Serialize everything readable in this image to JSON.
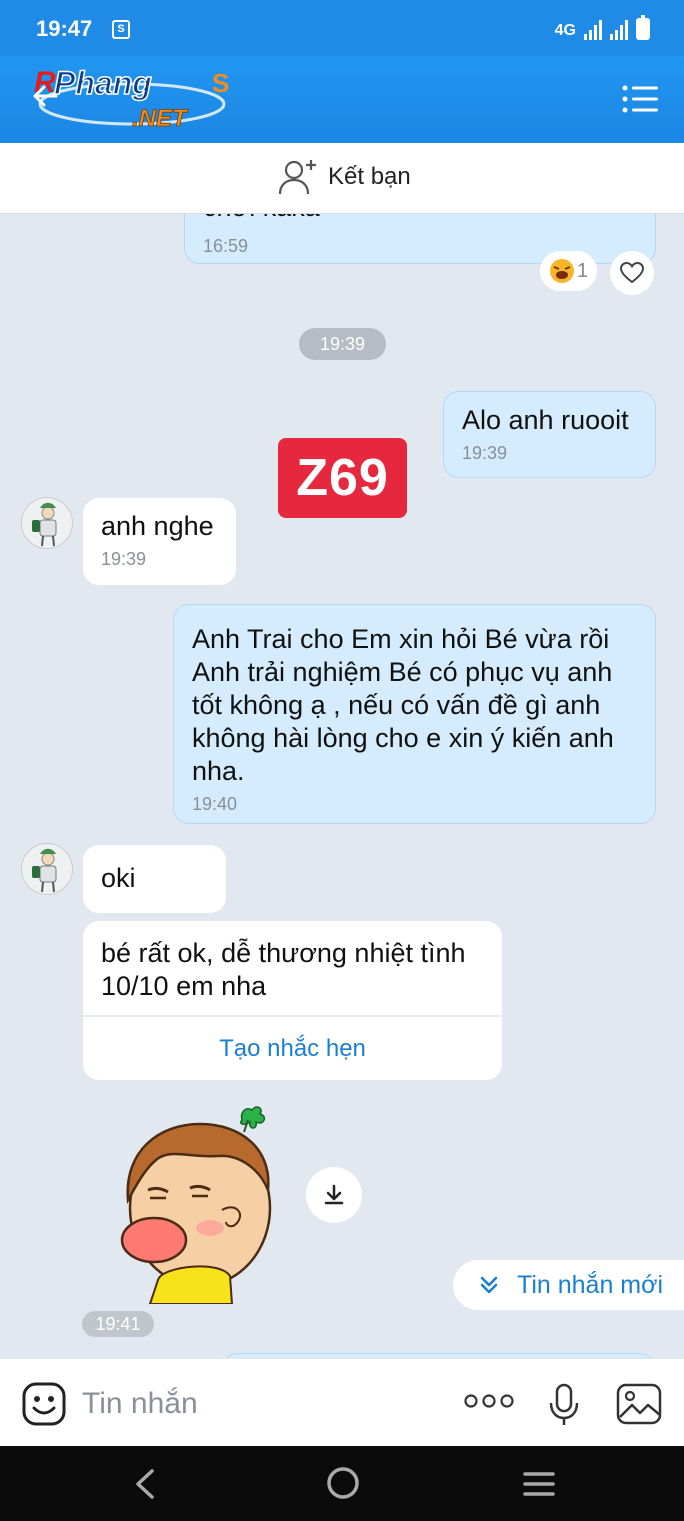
{
  "status_bar": {
    "time": "19:47",
    "bag_glyph": "S",
    "network": "4G"
  },
  "header": {
    "logo_text_top": "Phang",
    "logo_text_bottom": ".NET",
    "logo_prefix": "R",
    "logo_suffix": "S"
  },
  "friend_bar": {
    "label": "Kết bạn"
  },
  "chat": {
    "prev_message": {
      "text": "chơi kaka",
      "time": "16:59",
      "reaction_count": "1"
    },
    "time_divider": "19:39",
    "watermark": "Z69",
    "messages": [
      {
        "side": "me",
        "text": "Alo anh ruooit",
        "time": "19:39"
      },
      {
        "side": "other",
        "text": "anh nghe",
        "time": "19:39"
      },
      {
        "side": "me",
        "text": "Anh Trai cho Em xin hỏi Bé vừa rồi Anh trải nghiệm Bé có phục vụ anh tốt không ạ , nếu có vấn đề gì anh không hài lòng cho e xin ý kiến anh nha.",
        "time": "19:40"
      },
      {
        "side": "other",
        "text": "oki"
      }
    ],
    "card": {
      "text": "bé rất ok, dễ thương nhiệt tình 10/10 em nha",
      "action": "Tạo nhắc hẹn"
    },
    "sticker_time": "19:41",
    "new_messages_label": "Tin nhắn mới"
  },
  "composer": {
    "placeholder": "Tin nhắn"
  },
  "colors": {
    "header_blue": "#1f8be6",
    "my_bubble": "#d5ecff",
    "chat_bg": "#e2e8f0",
    "link_blue": "#1a7fd4",
    "watermark_red": "#e5283e"
  }
}
